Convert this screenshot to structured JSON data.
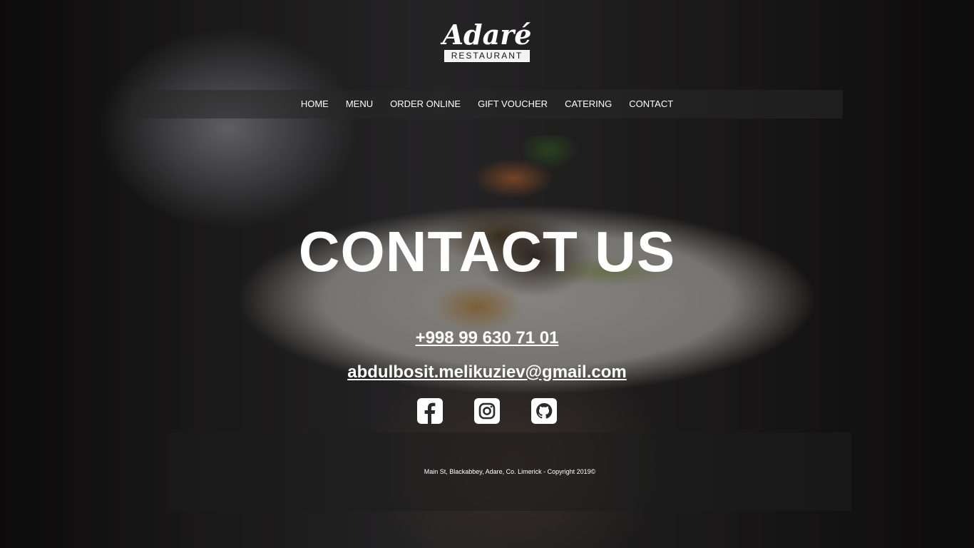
{
  "logo": {
    "name": "Adaré",
    "subtitle": "RESTAURANT"
  },
  "nav": {
    "items": [
      {
        "label": "HOME"
      },
      {
        "label": "MENU"
      },
      {
        "label": "ORDER ONLINE"
      },
      {
        "label": "GIFT VOUCHER"
      },
      {
        "label": "CATERING"
      },
      {
        "label": "CONTACT"
      }
    ]
  },
  "hero": {
    "title": "CONTACT US"
  },
  "contact": {
    "phone": "+998 99 630 71 01",
    "email": "abdulbosit.melikuziev@gmail.com"
  },
  "social": {
    "icons": [
      "facebook-icon",
      "instagram-icon",
      "github-icon"
    ]
  },
  "footer": {
    "text": "Main St, Blackabbey, Adare, Co. Limerick - Copyright 2019©"
  }
}
